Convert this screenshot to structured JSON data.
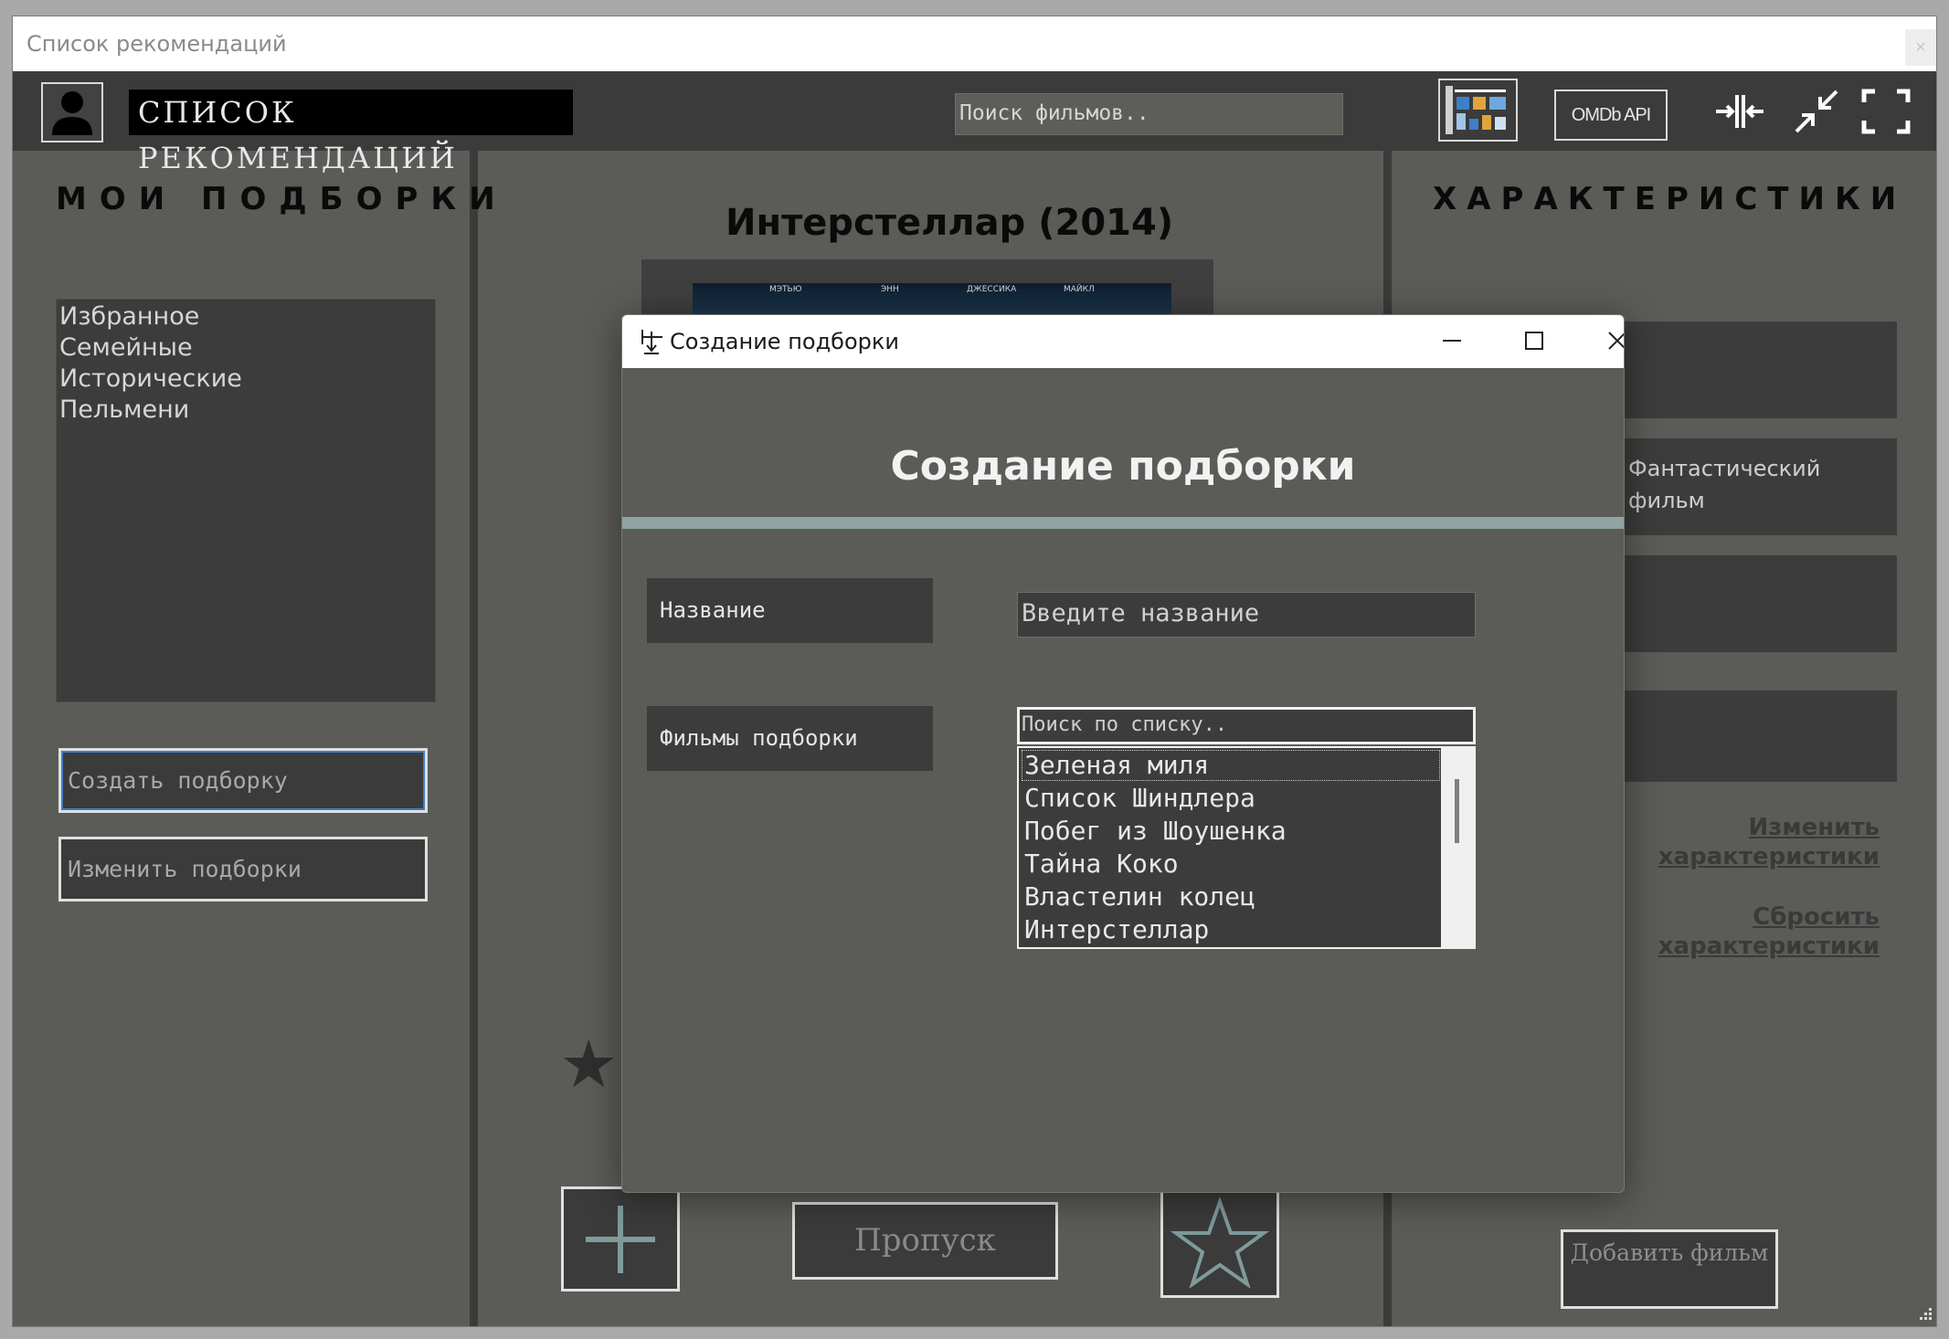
{
  "window": {
    "title": "Список рекомендаций",
    "close_label": "×"
  },
  "header": {
    "app_title": "СПИСОК РЕКОМЕНДАЦИЙ",
    "search_placeholder": "Поиск фильмов..",
    "omdb_label": "OMDb API"
  },
  "left_panel": {
    "title": "МОИ ПОДБОРКИ",
    "collections": [
      "Избранное",
      "Семейные",
      "Исторические",
      "Пельмени"
    ],
    "create_button": "Создать подборку",
    "edit_button": "Изменить подборки"
  },
  "center_panel": {
    "movie_title": "Интерстеллар (2014)",
    "poster_cast": [
      "МЭТЬЮ",
      "ЭНН",
      "ДЖЕССИКА",
      "МАЙКЛ"
    ],
    "skip_button": "Пропуск"
  },
  "right_panel": {
    "title": "ХАРАКТЕРИСТИКИ",
    "genre_text": "Фантастический фильм",
    "edit_link": "Изменить характеристики",
    "reset_link": "Сбросить характеристики",
    "add_film_button": "Добавить фильм"
  },
  "dialog": {
    "window_title": "Создание подборки",
    "heading": "Создание подборки",
    "name_label": "Название",
    "name_placeholder": "Введите название",
    "films_label": "Фильмы подборки",
    "list_search_placeholder": "Поиск по списку..",
    "films": [
      "Зеленая миля",
      "Список Шиндлера",
      "Побег из Шоушенка",
      "Тайна Коко",
      "Властелин колец",
      "Интерстеллар"
    ],
    "selected_index": 0
  },
  "colors": {
    "background": "#5b5c57",
    "panel_dark": "#3b3b3b",
    "accent_bar": "#8fa4a3",
    "icon_teal": "#7f9b9b"
  },
  "icons": [
    "user-icon",
    "dashboard-icon",
    "split-horizontal-icon",
    "shrink-icon",
    "fullscreen-icon",
    "star-icon",
    "plus-icon",
    "star-outline-icon",
    "resize-grip-icon"
  ]
}
